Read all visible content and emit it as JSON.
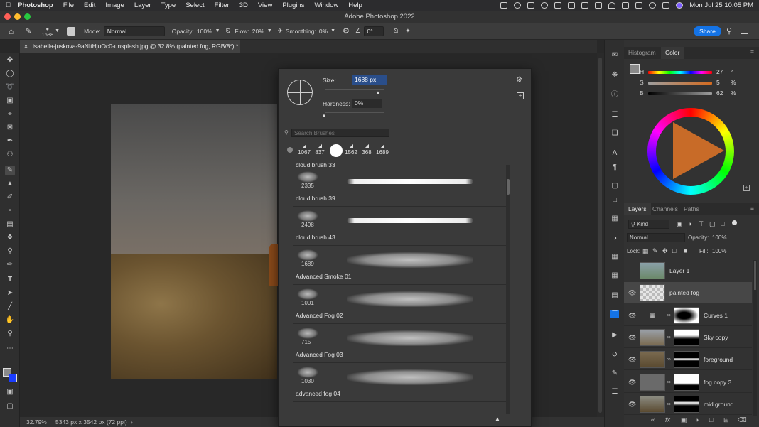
{
  "menubar": {
    "app": "Photoshop",
    "items": [
      "File",
      "Edit",
      "Image",
      "Layer",
      "Type",
      "Select",
      "Filter",
      "3D",
      "View",
      "Plugins",
      "Window",
      "Help"
    ],
    "datetime": "Mon Jul 25  10:05 PM"
  },
  "window": {
    "title": "Adobe Photoshop 2022"
  },
  "options": {
    "brush_size": "1688",
    "mode_label": "Mode:",
    "mode_value": "Normal",
    "opacity_label": "Opacity:",
    "opacity_value": "100%",
    "flow_label": "Flow:",
    "flow_value": "20%",
    "smoothing_label": "Smoothing:",
    "smoothing_value": "0%",
    "angle_value": "0°",
    "share_label": "Share"
  },
  "document": {
    "tab_title": "isabella-juskova-9aNItHjuOc0-unsplash.jpg @ 32.8% (painted fog, RGB/8*) *"
  },
  "status": {
    "zoom": "32.79%",
    "dims": "5343 px x 3542 px (72 ppi)"
  },
  "brush_popup": {
    "size_label": "Size:",
    "size_value": "1688 px",
    "hardness_label": "Hardness:",
    "hardness_value": "0%",
    "search_placeholder": "Search Brushes",
    "recent": [
      "1067",
      "837",
      "1562",
      "368",
      "1689"
    ],
    "partial_label": "cloud brush 33",
    "brushes": [
      {
        "num": "2335",
        "name": "cloud brush 39",
        "style": "solid"
      },
      {
        "num": "2498",
        "name": "cloud brush 43",
        "style": "solid"
      },
      {
        "num": "1689",
        "name": "Advanced Smoke 01",
        "style": "fog"
      },
      {
        "num": "1001",
        "name": "Advanced Fog 02",
        "style": "fog"
      },
      {
        "num": "715",
        "name": "Advanced Fog 03",
        "style": "fog"
      },
      {
        "num": "1030",
        "name": "advanced fog 04",
        "style": "fog"
      }
    ]
  },
  "color_panel": {
    "tabs": [
      "Histogram",
      "Color"
    ],
    "h_label": "H",
    "h_value": "27",
    "h_unit": "°",
    "s_label": "S",
    "s_value": "5",
    "s_unit": "%",
    "b_label": "B",
    "b_value": "62",
    "b_unit": "%"
  },
  "layers_panel": {
    "tabs": [
      "Layers",
      "Channels",
      "Paths"
    ],
    "kind_label": "Kind",
    "blend_mode": "Normal",
    "opacity_label": "Opacity:",
    "opacity_value": "100%",
    "lock_label": "Lock:",
    "fill_label": "Fill:",
    "fill_value": "100%",
    "layers": [
      {
        "name": "Layer 1",
        "visible": false,
        "mask": false
      },
      {
        "name": "painted fog",
        "visible": true,
        "mask": false,
        "selected": true
      },
      {
        "name": "Curves 1",
        "visible": true,
        "mask": true
      },
      {
        "name": "Sky copy",
        "visible": true,
        "mask": true
      },
      {
        "name": "foreground",
        "visible": true,
        "mask": true
      },
      {
        "name": "fog copy 3",
        "visible": true,
        "mask": true
      },
      {
        "name": "mid ground",
        "visible": true,
        "mask": true
      }
    ]
  },
  "colors": {
    "accent": "#1473e6",
    "foreground": "#8a8a8a",
    "background": "#1a3cff"
  }
}
